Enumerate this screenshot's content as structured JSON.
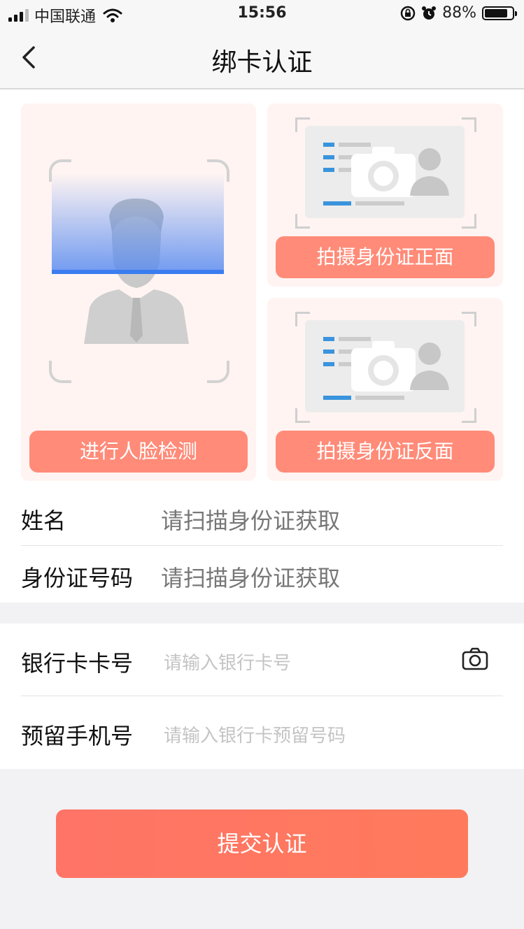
{
  "status_bar": {
    "carrier": "中国联通",
    "time": "15:56",
    "battery_percent": "88%",
    "battery_level": 0.88,
    "icons": [
      "signal-icon",
      "wifi-icon",
      "rotation-lock-icon",
      "alarm-icon",
      "battery-icon"
    ]
  },
  "nav": {
    "title": "绑卡认证",
    "back_icon": "chevron-left-icon"
  },
  "capture": {
    "face_button": "进行人脸检测",
    "id_front_button": "拍摄身份证正面",
    "id_back_button": "拍摄身份证反面"
  },
  "identity": {
    "name_label": "姓名",
    "name_value": "请扫描身份证获取",
    "id_label": "身份证号码",
    "id_value": "请扫描身份证获取"
  },
  "bank": {
    "card_label": "银行卡卡号",
    "card_placeholder": "请输入银行卡号",
    "phone_label": "预留手机号",
    "phone_placeholder": "请输入银行卡预留号码",
    "camera_icon": "camera-icon"
  },
  "submit_label": "提交认证",
  "colors": {
    "accent": "#ff8b78",
    "submit": "#ff7466",
    "card_bg": "#fff4f2",
    "scan_blue": "#3b7df0"
  }
}
